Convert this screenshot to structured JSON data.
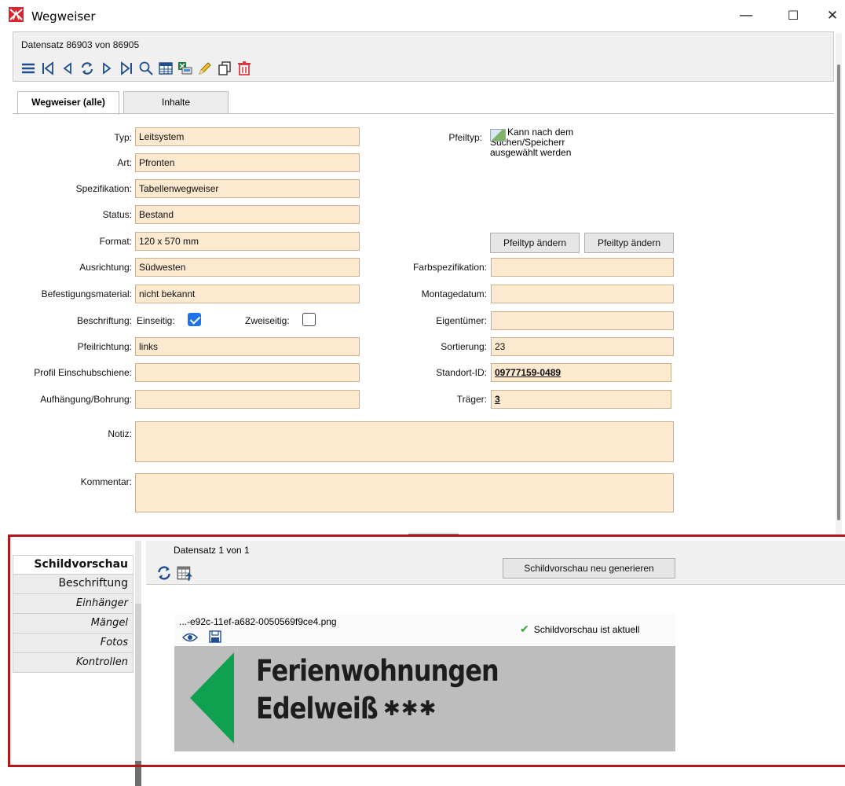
{
  "window": {
    "title": "Wegweiser",
    "minimize": "—",
    "maximize": "☐",
    "close": "✕"
  },
  "navigator": {
    "record": "Datensatz 86903 von 86905",
    "toolbar_icons": [
      "menu-icon",
      "first-record-icon",
      "previous-record-icon",
      "refresh-icon",
      "next-record-icon",
      "last-record-icon",
      "search-icon",
      "table-view-icon",
      "excel-export-icon",
      "edit-pencil-icon",
      "copy-icon",
      "delete-icon"
    ]
  },
  "tabs": [
    {
      "label": "Wegweiser (alle)",
      "active": true
    },
    {
      "label": "Inhalte",
      "active": false
    }
  ],
  "form": {
    "typ": {
      "label": "Typ:",
      "value": "Leitsystem"
    },
    "art": {
      "label": "Art:",
      "value": "Pfronten"
    },
    "spezifikation": {
      "label": "Spezifikation:",
      "value": "Tabellenwegweiser"
    },
    "status": {
      "label": "Status:",
      "value": "Bestand"
    },
    "format": {
      "label": "Format:",
      "value": "120 x 570 mm"
    },
    "ausrichtung": {
      "label": "Ausrichtung:",
      "value": "Südwesten"
    },
    "befestigung": {
      "label": "Befestigungsmaterial:",
      "value": "nicht bekannt"
    },
    "beschriftung": {
      "label": "Beschriftung:",
      "einseitig": "Einseitig:",
      "einseitig_checked": true,
      "zweiseitig": "Zweiseitig:",
      "zweiseitig_checked": false
    },
    "pfeilrichtung": {
      "label": "Pfeilrichtung:",
      "value": "links"
    },
    "profil": {
      "label": "Profil Einschubschiene:",
      "value": ""
    },
    "aufhaengung": {
      "label": "Aufhängung/Bohrung:",
      "value": ""
    },
    "notiz": {
      "label": "Notiz:",
      "value": ""
    },
    "kommentar": {
      "label": "Kommentar:",
      "value": ""
    },
    "pfeiltyp": {
      "label": "Pfeiltyp:",
      "alt_text": "Kann nach dem Suchen/Speicherr ausgewählt werden"
    },
    "pfeiltyp_btn1": "Pfeiltyp ändern",
    "pfeiltyp_btn2": "Pfeiltyp ändern",
    "farbspezifikation": {
      "label": "Farbspezifikation:",
      "value": ""
    },
    "montagedatum": {
      "label": "Montagedatum:",
      "value": ""
    },
    "eigentuemer": {
      "label": "Eigentümer:",
      "value": ""
    },
    "sortierung": {
      "label": "Sortierung:",
      "value": "23"
    },
    "standort": {
      "label": "Standort-ID:",
      "value": "09777159-0489"
    },
    "traeger": {
      "label": "Träger:",
      "value": "3"
    }
  },
  "bottom": {
    "left_tabs": [
      {
        "label": "Schildvorschau",
        "active": true,
        "italic": false
      },
      {
        "label": "Beschriftung",
        "active": false,
        "italic": false
      },
      {
        "label": "Einhänger",
        "active": false,
        "italic": true
      },
      {
        "label": "Mängel",
        "active": false,
        "italic": true
      },
      {
        "label": "Fotos",
        "active": false,
        "italic": true
      },
      {
        "label": "Kontrollen",
        "active": false,
        "italic": true
      }
    ],
    "record": "Datensatz 1 von 1",
    "regenerate_button": "Schildvorschau neu generieren",
    "file_name": "...-e92c-11ef-a682-0050569f9ce4.png",
    "status": "Schildvorschau ist aktuell",
    "sign": {
      "line1": "Ferienwohnungen",
      "line2": "Edelweiß",
      "stars": "✱✱✱",
      "arrow_color": "#0fa050",
      "background_color": "#bdbdbd"
    }
  }
}
